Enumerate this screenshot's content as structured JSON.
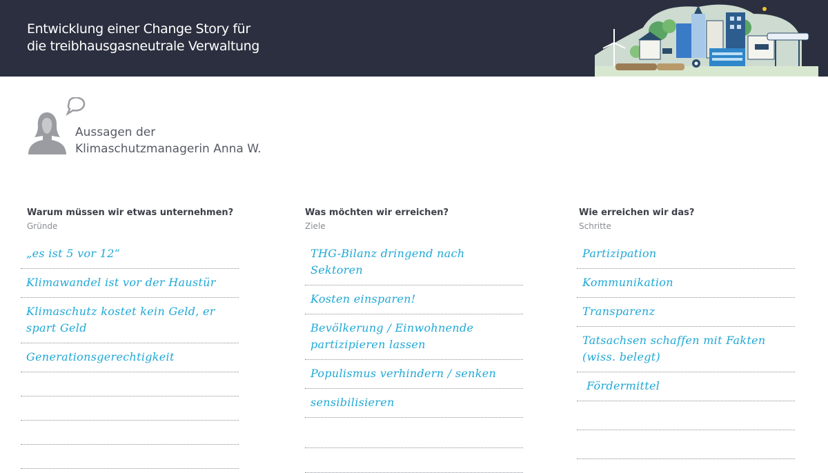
{
  "header": {
    "title_line1": "Entwicklung einer Change Story für",
    "title_line2": "die treibhausgasneutrale Verwaltung",
    "accent_color": "#2b2f3f"
  },
  "speaker": {
    "line1": "Aussagen der",
    "line2": "Klimaschutzmanagerin Anna W."
  },
  "columns": [
    {
      "heading": "Warum müssen wir etwas unternehmen?",
      "subheading": "Gründe",
      "entries": [
        "„es ist 5 vor 12“",
        "Klimawandel ist vor der Haustür",
        "Klimaschutz kostet kein Geld, er spart Geld",
        "Generationsgerechtigkeit",
        "",
        "",
        "",
        ""
      ]
    },
    {
      "heading": "Was möchten wir erreichen?",
      "subheading": "Ziele",
      "entries": [
        "THG-Bilanz dringend nach Sektoren",
        "Kosten einsparen!",
        "Bevölkerung / Einwohnende partizipieren lassen",
        "Populismus verhindern / senken",
        "sensibilisieren",
        "",
        ""
      ]
    },
    {
      "heading": "Wie erreichen wir das?",
      "subheading": "Schritte",
      "entries": [
        "Partizipation",
        "Kommunikation",
        "Transparenz",
        "Tatsachsen schaffen mit Fakten (wiss. belegt)",
        "Fördermittel",
        "",
        ""
      ]
    }
  ],
  "colors": {
    "handwriting": "#1fa8d6",
    "text_dark": "#3c3f47",
    "text_muted": "#8a8d93"
  }
}
